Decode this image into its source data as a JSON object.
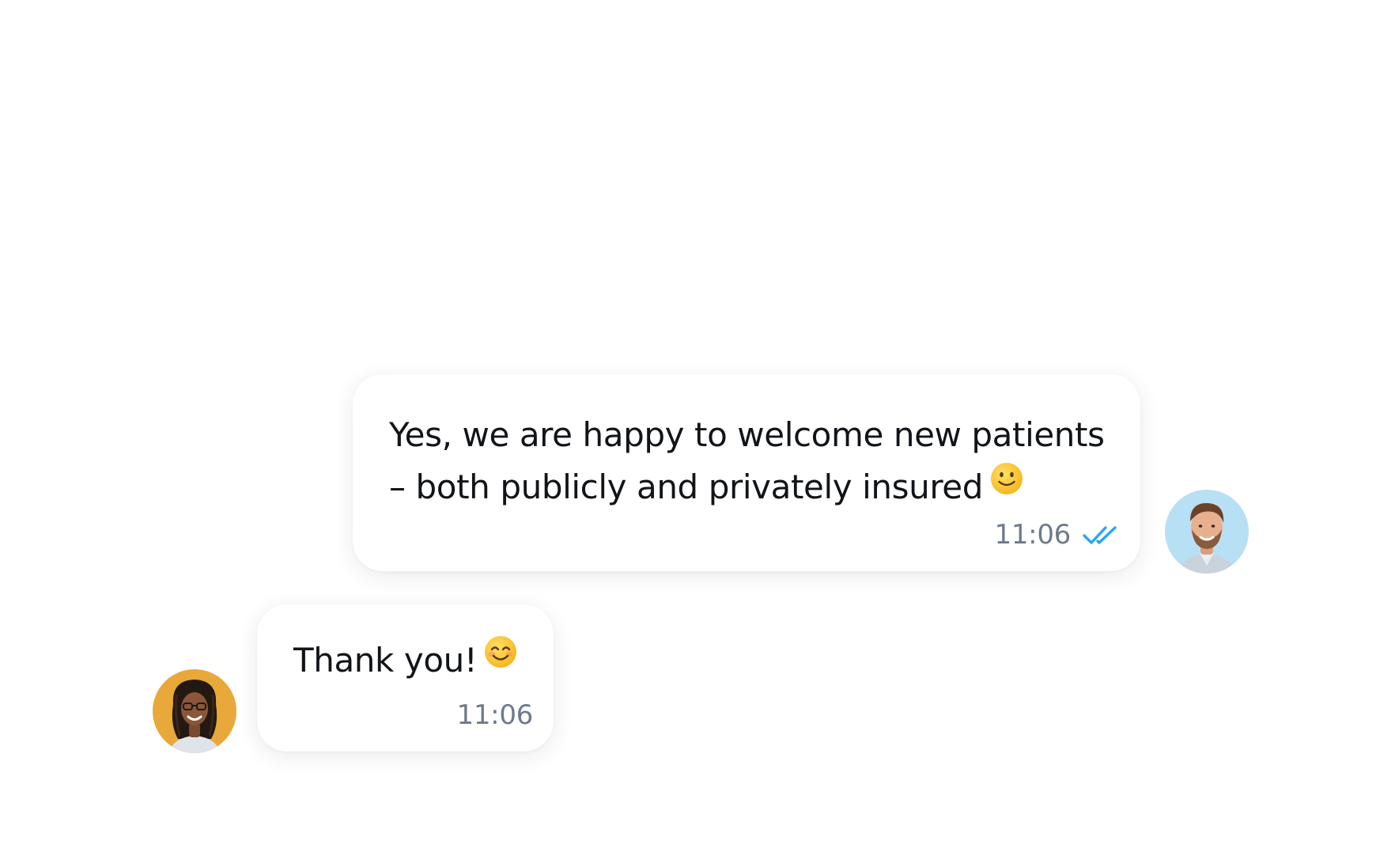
{
  "conversation": {
    "messages": [
      {
        "direction": "outgoing",
        "line1": "Yes, we are happy to welcome new patients",
        "line2": "– both publicly and privately insured",
        "emoji": "slightly-smiling-face",
        "time": "11:06",
        "status": "read",
        "avatar": "male-avatar"
      },
      {
        "direction": "incoming",
        "text": "Thank you!",
        "emoji": "smiling-face-with-smiling-eyes",
        "time": "11:06",
        "avatar": "female-avatar"
      }
    ]
  },
  "colors": {
    "background": "#ffffff",
    "bubble": "#ffffff",
    "text": "#111418",
    "timestamp": "#6e7a8c",
    "read_ticks": "#2aa6ee",
    "male_avatar_bg": "#b8e0f4",
    "female_avatar_bg": "#e8a93a"
  }
}
